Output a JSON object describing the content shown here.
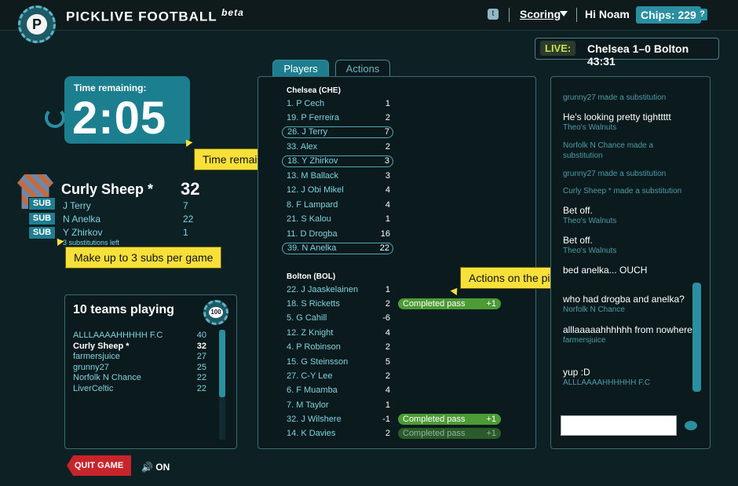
{
  "header": {
    "brand_main": "PICKLIVE FOOTBALL",
    "brand_beta": "beta",
    "logo_letter": "P",
    "twitter_icon": "twitter-icon",
    "scoring_label": "Scoring",
    "greeting": "Hi Noam",
    "chips_label": "Chips: 229",
    "help_label": "?"
  },
  "live": {
    "label": "LIVE:",
    "match": "Chelsea 1–0 Bolton 43:31"
  },
  "timer": {
    "label": "Time remaining:",
    "value": "2:05"
  },
  "tooltips": {
    "time": "Time remaining",
    "subs": "Make up to 3 subs per game",
    "actions": "Actions on the pitch"
  },
  "my_team": {
    "name": "Curly Sheep *",
    "score": "32",
    "sub_label": "SUB",
    "picks": [
      {
        "name": "J Terry",
        "pts": "7"
      },
      {
        "name": "N Anelka",
        "pts": "22"
      },
      {
        "name": "Y Zhirkov",
        "pts": "1"
      }
    ],
    "subs_left": "3 substitutions left"
  },
  "teams": {
    "title": "10 teams playing",
    "badge": "100",
    "list": [
      {
        "name": "ALLLAAAAHHHHH F.C",
        "pts": "40"
      },
      {
        "name": "Curly Sheep *",
        "pts": "32"
      },
      {
        "name": "farmersjuice",
        "pts": "27"
      },
      {
        "name": "grunny27",
        "pts": "25"
      },
      {
        "name": "Norfolk N Chance",
        "pts": "22"
      },
      {
        "name": "LiverCeltic",
        "pts": "22"
      }
    ]
  },
  "controls": {
    "quit": "QUIT GAME",
    "sound": "ON"
  },
  "tabs": {
    "players": "Players",
    "actions": "Actions"
  },
  "chelsea": {
    "title": "Chelsea (CHE)",
    "players": [
      {
        "name": "1. P Cech",
        "pts": "1"
      },
      {
        "name": "19. P Ferreira",
        "pts": "2"
      },
      {
        "name": "26. J Terry",
        "pts": "7"
      },
      {
        "name": "33. Alex",
        "pts": "2"
      },
      {
        "name": "18. Y Zhirkov",
        "pts": "3"
      },
      {
        "name": "13. M Ballack",
        "pts": "3"
      },
      {
        "name": "12. J Obi Mikel",
        "pts": "4"
      },
      {
        "name": "8. F Lampard",
        "pts": "4"
      },
      {
        "name": "21. S Kalou",
        "pts": "1"
      },
      {
        "name": "11. D Drogba",
        "pts": "16"
      },
      {
        "name": "39. N Anelka",
        "pts": "22"
      }
    ]
  },
  "bolton": {
    "title": "Bolton (BOL)",
    "players": [
      {
        "name": "22. J Jaaskelainen",
        "pts": "1"
      },
      {
        "name": "18. S Ricketts",
        "pts": "2"
      },
      {
        "name": "5. G Cahill",
        "pts": "-6"
      },
      {
        "name": "12. Z Knight",
        "pts": "4"
      },
      {
        "name": "4. P Robinson",
        "pts": "2"
      },
      {
        "name": "15. G Steinsson",
        "pts": "5"
      },
      {
        "name": "27. C-Y Lee",
        "pts": "2"
      },
      {
        "name": "6. F Muamba",
        "pts": "4"
      },
      {
        "name": "7. M Taylor",
        "pts": "1"
      },
      {
        "name": "32. J Wilshere",
        "pts": "-1"
      },
      {
        "name": "14. K Davies",
        "pts": "2"
      }
    ],
    "actions": [
      {
        "label": "Completed pass",
        "value": "+1"
      },
      {
        "label": "Completed pass",
        "value": "+1"
      },
      {
        "label": "Completed pass",
        "value": "+1"
      }
    ]
  },
  "chat": [
    {
      "sys": "grunny27 made a substitution"
    },
    {
      "msg": "He's looking pretty tighttttt",
      "user": "Theo's Walnuts"
    },
    {
      "sys": "Norfolk N Chance made a substitution"
    },
    {
      "sys": "grunny27 made a substitution"
    },
    {
      "sys": "Curly Sheep * made a substitution"
    },
    {
      "msg": "Bet off.",
      "user": "Theo's Walnuts"
    },
    {
      "msg": "Bet off.",
      "user": "Theo's Walnuts"
    },
    {
      "msg": "bed anelka... OUCH",
      "user": ""
    },
    {
      "msg": "who had drogba and anelka?",
      "user": "Norfolk N Chance"
    },
    {
      "msg": "alllaaaaahhhhhh from nowhere",
      "user": "farmersjuice"
    },
    {
      "msg": "yup :D",
      "user": "ALLLAAAAHHHHHH F.C"
    }
  ]
}
